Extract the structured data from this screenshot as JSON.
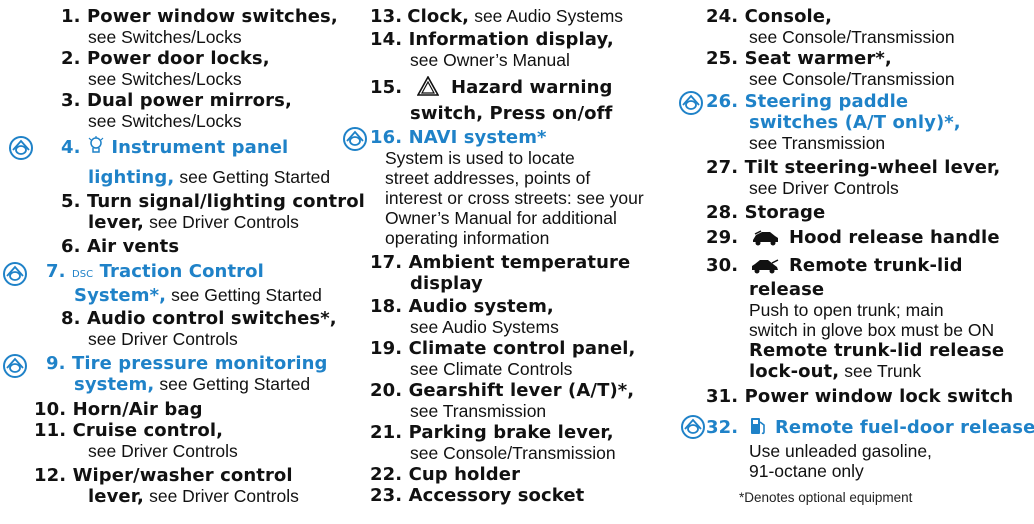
{
  "colors": {
    "highlight": "#1f82c8",
    "text": "#111111"
  },
  "items": {
    "i1": {
      "num": "1.",
      "title": "Power window switches,",
      "ref": "see Switches/Locks"
    },
    "i2": {
      "num": "2.",
      "title": "Power door locks,",
      "ref": "see Switches/Locks"
    },
    "i3": {
      "num": "3.",
      "title": "Dual power mirrors,",
      "ref": "see Switches/Locks"
    },
    "i4": {
      "num": "4.",
      "title": "Instrument panel",
      "title2": "lighting,",
      "ref": "see Getting Started",
      "icon": "light-bulb-icon"
    },
    "i5": {
      "num": "5.",
      "title": "Turn signal/lighting control",
      "title2": "lever,",
      "ref": "see Driver Controls"
    },
    "i6": {
      "num": "6.",
      "title": "Air vents"
    },
    "i7": {
      "num": "7.",
      "dsc": "DSC",
      "title": "Traction Control",
      "title2": "System*,",
      "ref": "see Getting Started"
    },
    "i8": {
      "num": "8.",
      "title": "Audio control switches*,",
      "ref": "see Driver Controls"
    },
    "i9": {
      "num": "9.",
      "title": "Tire pressure monitoring",
      "title2": "system,",
      "ref": "see Getting Started"
    },
    "i10": {
      "num": "10.",
      "title": "Horn/Air bag"
    },
    "i11": {
      "num": "11.",
      "title": "Cruise control,",
      "ref": "see Driver Controls"
    },
    "i12": {
      "num": "12.",
      "title": "Wiper/washer control",
      "title2": "lever,",
      "ref": "see Driver Controls"
    },
    "i13": {
      "num": "13.",
      "title": "Clock,",
      "ref": "see Audio Systems"
    },
    "i14": {
      "num": "14.",
      "title": "Information display,",
      "ref": "see Owner’s Manual"
    },
    "i15": {
      "num": "15.",
      "title": "Hazard warning",
      "title2": "switch, Press on/off",
      "icon": "hazard-triangle-icon"
    },
    "i16": {
      "num": "16.",
      "title": "NAVI system*",
      "desc": [
        "System is used to locate",
        "street addresses, points of",
        "interest or cross streets: see your",
        "Owner’s Manual for additional",
        "operating information"
      ]
    },
    "i17": {
      "num": "17.",
      "title": "Ambient temperature",
      "title2": "display"
    },
    "i18": {
      "num": "18.",
      "title": "Audio system,",
      "ref": "see Audio Systems"
    },
    "i19": {
      "num": "19.",
      "title": "Climate control panel,",
      "ref": "see Climate Controls"
    },
    "i20": {
      "num": "20.",
      "title": "Gearshift lever (A/T)*,",
      "ref": "see Transmission"
    },
    "i21": {
      "num": "21.",
      "title": "Parking brake lever,",
      "ref": "see Console/Transmission"
    },
    "i22": {
      "num": "22.",
      "title": "Cup holder"
    },
    "i23": {
      "num": "23.",
      "title": "Accessory socket"
    },
    "i24": {
      "num": "24.",
      "title": "Console,",
      "ref": "see Console/Transmission"
    },
    "i25": {
      "num": "25.",
      "title": "Seat warmer*,",
      "ref": "see Console/Transmission"
    },
    "i26": {
      "num": "26.",
      "title": "Steering paddle",
      "title2": "switches (A/T only)*,",
      "ref": "see Transmission"
    },
    "i27": {
      "num": "27.",
      "title": "Tilt steering-wheel lever,",
      "ref": "see Driver Controls"
    },
    "i28": {
      "num": "28.",
      "title": "Storage"
    },
    "i29": {
      "num": "29.",
      "title": "Hood release handle",
      "icon": "car-hood-icon"
    },
    "i30": {
      "num": "30.",
      "title": "Remote trunk-lid",
      "title2": "release",
      "desc": [
        "Push to open trunk; main",
        "switch in glove box must be ON"
      ],
      "sub_title": "Remote trunk-lid release",
      "sub_title2": "lock-out,",
      "sub_ref": "see Trunk",
      "icon": "car-trunk-icon"
    },
    "i31": {
      "num": "31.",
      "title": "Power window lock switch"
    },
    "i32": {
      "num": "32.",
      "title": "Remote fuel-door release",
      "desc": [
        "Use unleaded gasoline,",
        "91-octane only"
      ],
      "icon": "fuel-pump-icon"
    }
  },
  "footnote": "*Denotes optional equipment",
  "marker_icon": "circle-marker-icon"
}
